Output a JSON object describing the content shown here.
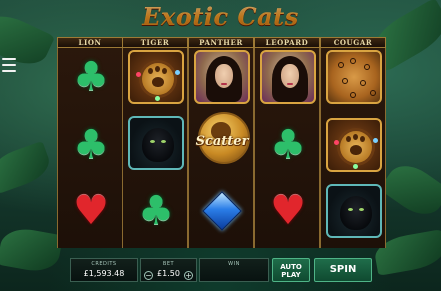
{
  "game": {
    "title": "Exotic Cats"
  },
  "reels": [
    {
      "label": "LION",
      "symbols": [
        "club",
        "club",
        "heart"
      ]
    },
    {
      "label": "TIGER",
      "symbols": [
        "paw-tile",
        "panther",
        "club"
      ]
    },
    {
      "label": "PANTHER",
      "symbols": [
        "woman",
        "scatter",
        "diamond"
      ]
    },
    {
      "label": "LEOPARD",
      "symbols": [
        "woman",
        "club",
        "heart"
      ]
    },
    {
      "label": "COUGAR",
      "symbols": [
        "jaguar",
        "paw-tile",
        "panther"
      ]
    }
  ],
  "scatter_label": "Scatter",
  "controls": {
    "credits_label": "CREDITS",
    "credits_value": "£1,593.48",
    "bet_label": "BET",
    "bet_value": "£1.50",
    "bet_minus": "−",
    "bet_plus": "+",
    "win_label": "WIN",
    "win_value": "",
    "autoplay_line1": "AUTO",
    "autoplay_line2": "PLAY",
    "spin_label": "SPIN"
  },
  "colors": {
    "accent_green": "#1f6d4a",
    "frame_gold": "#9d7a35",
    "club": "#2dbf6a",
    "heart": "#e1262c",
    "diamond": "#2b7ee8"
  },
  "icons": {
    "menu": "hamburger-menu-icon"
  }
}
